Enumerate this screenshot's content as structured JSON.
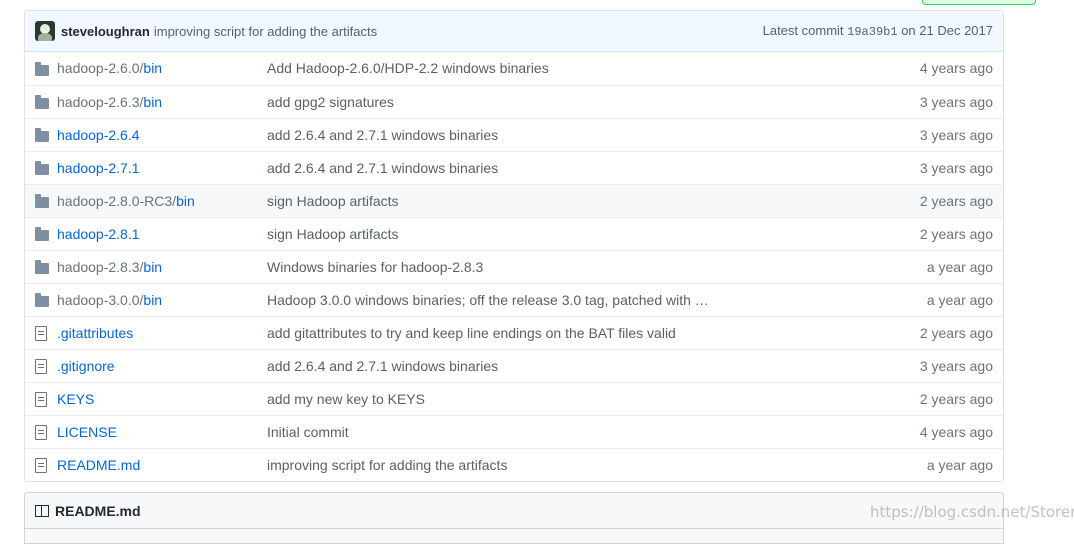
{
  "commit": {
    "author": "steveloughran",
    "message": "improving script for adding the artifacts",
    "latest_label": "Latest commit",
    "sha": "19a39b1",
    "date": "on 21 Dec 2017"
  },
  "files": [
    {
      "type": "folder",
      "name": "hadoop-2.6.0/",
      "link_part": "bin",
      "message": "Add Hadoop-2.6.0/HDP-2.2 windows binaries",
      "age": "4 years ago"
    },
    {
      "type": "folder",
      "name": "hadoop-2.6.3/",
      "link_part": "bin",
      "message": "add gpg2 signatures",
      "age": "3 years ago"
    },
    {
      "type": "folder",
      "name": "",
      "link_part": "hadoop-2.6.4",
      "message": "add 2.6.4 and 2.7.1 windows binaries",
      "age": "3 years ago"
    },
    {
      "type": "folder",
      "name": "",
      "link_part": "hadoop-2.7.1",
      "message": "add 2.6.4 and 2.7.1 windows binaries",
      "age": "3 years ago"
    },
    {
      "type": "folder",
      "name": "hadoop-2.8.0-RC3/",
      "link_part": "bin",
      "message": "sign Hadoop artifacts",
      "age": "2 years ago"
    },
    {
      "type": "folder",
      "name": "",
      "link_part": "hadoop-2.8.1",
      "message": "sign Hadoop artifacts",
      "age": "2 years ago"
    },
    {
      "type": "folder",
      "name": "hadoop-2.8.3/",
      "link_part": "bin",
      "message": "Windows binaries for hadoop-2.8.3",
      "age": "a year ago"
    },
    {
      "type": "folder",
      "name": "hadoop-3.0.0/",
      "link_part": "bin",
      "message": "Hadoop 3.0.0 windows binaries; off the release 3.0 tag, patched with …",
      "age": "a year ago"
    },
    {
      "type": "file",
      "name": "",
      "link_part": ".gitattributes",
      "message": "add gitattributes to try and keep line endings on the BAT files valid",
      "age": "2 years ago"
    },
    {
      "type": "file",
      "name": "",
      "link_part": ".gitignore",
      "message": "add 2.6.4 and 2.7.1 windows binaries",
      "age": "3 years ago"
    },
    {
      "type": "file",
      "name": "",
      "link_part": "KEYS",
      "message": "add my new key to KEYS",
      "age": "2 years ago"
    },
    {
      "type": "file",
      "name": "",
      "link_part": "LICENSE",
      "message": "Initial commit",
      "age": "4 years ago"
    },
    {
      "type": "file",
      "name": "",
      "link_part": "README.md",
      "message": "improving script for adding the artifacts",
      "age": "a year ago"
    }
  ],
  "readme": {
    "title": "README.md"
  },
  "watermark": "https://blog.csdn.net/Storery"
}
